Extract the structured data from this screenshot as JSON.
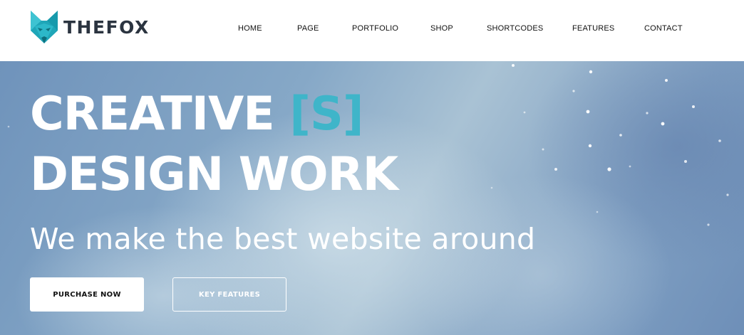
{
  "header": {
    "logo_text": "THEFOX",
    "nav": [
      {
        "label": "HOME",
        "name": "nav-item-home"
      },
      {
        "label": "PAGE",
        "name": "nav-item-page"
      },
      {
        "label": "PORTFOLIO",
        "name": "nav-item-portfolio"
      },
      {
        "label": "SHOP",
        "name": "nav-item-shop"
      },
      {
        "label": "SHORTCODES",
        "name": "nav-item-shortcodes"
      },
      {
        "label": "FEATURES",
        "name": "nav-item-features"
      },
      {
        "label": "CONTACT",
        "name": "nav-item-contact"
      }
    ]
  },
  "hero": {
    "headline_line1": "CREATIVE",
    "headline_accent": "[S]",
    "headline_line2": "DESIGN WORK",
    "tagline": "We make the best website around",
    "primary_button": "PURCHASE NOW",
    "secondary_button": "KEY FEATURES"
  },
  "colors": {
    "accent": "#3fb5c9",
    "logo_dark": "#2b3440",
    "hero_blue": "#6f93bb"
  },
  "icons": {
    "logo": "fox-head-icon"
  }
}
